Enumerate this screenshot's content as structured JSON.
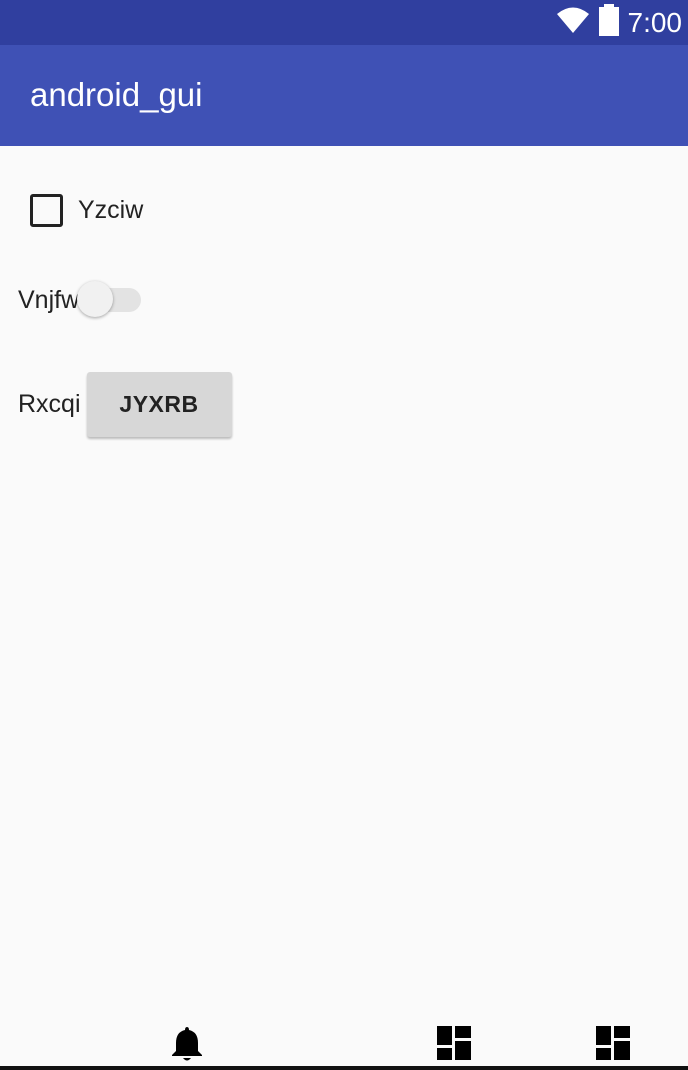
{
  "status_bar": {
    "time": "7:00",
    "icons": [
      "wifi-icon",
      "battery-icon"
    ],
    "color": "#303f9f"
  },
  "app_bar": {
    "title": "android_gui",
    "color": "#3f51b5"
  },
  "content": {
    "checkbox": {
      "label": "Yzciw",
      "checked": false
    },
    "switch": {
      "label": "Vnjfw",
      "on": false
    },
    "button_row": {
      "label": "Rxcqi",
      "button_label": "JYXRB"
    }
  },
  "bottom_icons": [
    "bell-icon",
    "dashboard-icon",
    "dashboard-icon"
  ]
}
